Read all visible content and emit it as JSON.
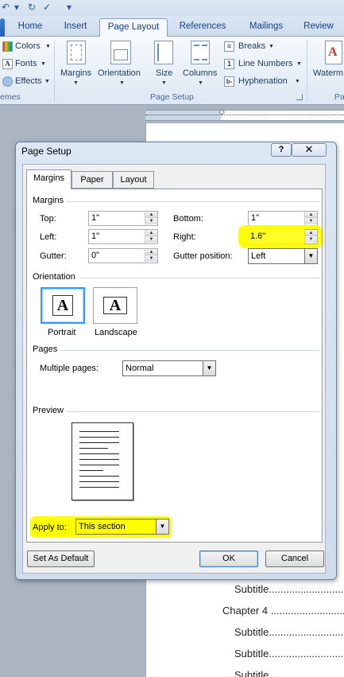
{
  "ribbon": {
    "tabs": [
      "Home",
      "Insert",
      "Page Layout",
      "References",
      "Mailings",
      "Review"
    ],
    "active_tab": "Page Layout",
    "themes": {
      "colors": "Colors",
      "fonts": "Fonts",
      "effects": "Effects",
      "label": "emes"
    },
    "page_setup": {
      "margins": "Margins",
      "orientation": "Orientation",
      "size": "Size",
      "columns": "Columns",
      "breaks": "Breaks",
      "line_numbers": "Line Numbers",
      "hyphenation": "Hyphenation",
      "label": "Page Setup"
    },
    "watermark": "Waterm",
    "pa_label": "Pa"
  },
  "dialog": {
    "title": "Page Setup",
    "help": "?",
    "close": "✕",
    "tabs": [
      "Margins",
      "Paper",
      "Layout"
    ],
    "active_tab": "Margins",
    "margins_section": "Margins",
    "top_label": "Top:",
    "top_value": "1\"",
    "bottom_label": "Bottom:",
    "bottom_value": "1\"",
    "left_label": "Left:",
    "left_value": "1\"",
    "right_label": "Right:",
    "right_value": "1.6\"",
    "gutter_label": "Gutter:",
    "gutter_value": "0\"",
    "gutter_pos_label": "Gutter position:",
    "gutter_pos_value": "Left",
    "orientation_section": "Orientation",
    "portrait": "Portrait",
    "landscape": "Landscape",
    "orientation_glyph": "A",
    "pages_section": "Pages",
    "multiple_pages_label": "Multiple pages:",
    "multiple_pages_value": "Normal",
    "preview_section": "Preview",
    "apply_to_label": "Apply to:",
    "apply_to_value": "This section",
    "set_default": "Set As Default",
    "ok": "OK",
    "cancel": "Cancel"
  },
  "document": {
    "toc_lines": [
      "Subtitle.............................",
      "Chapter 4 ..........................",
      "Subtitle.............................",
      "Subtitle.............................",
      "Subtitle"
    ]
  },
  "colors": {
    "highlight": "#ffff00",
    "selected_tab_border": "#3399ff"
  }
}
